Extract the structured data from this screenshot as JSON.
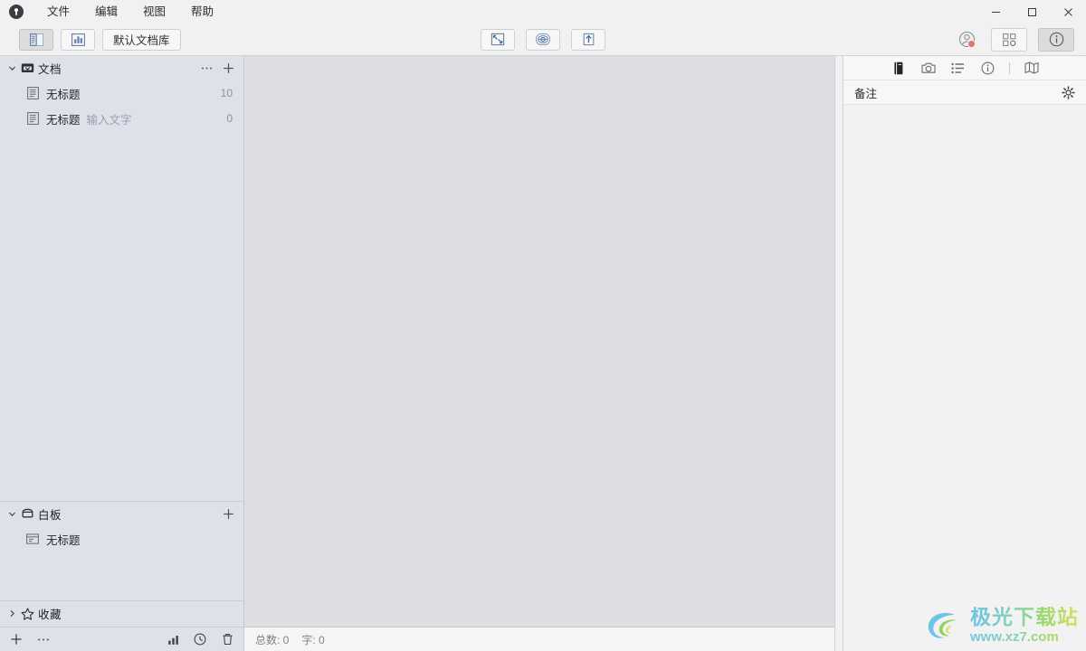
{
  "titlebar": {
    "logo_icon": "app-logo-icon",
    "menus": [
      {
        "label": "文件",
        "name": "menu-file"
      },
      {
        "label": "编辑",
        "name": "menu-edit"
      },
      {
        "label": "视图",
        "name": "menu-view"
      },
      {
        "label": "帮助",
        "name": "menu-help"
      }
    ],
    "window_controls": {
      "minimize": "minimize-icon",
      "maximize": "maximize-icon",
      "close": "close-icon"
    }
  },
  "toolbar": {
    "left": [
      {
        "name": "toggle-sidebar-button",
        "icon": "sidebar-panel-icon",
        "active": true
      },
      {
        "name": "toggle-outline-button",
        "icon": "bar-chart-icon",
        "active": false
      }
    ],
    "library_label": "默认文档库",
    "center": [
      {
        "name": "focus-mode-button",
        "icon": "expand-arrows-icon"
      },
      {
        "name": "typewriter-mode-button",
        "icon": "eye-target-icon"
      },
      {
        "name": "export-button",
        "icon": "upload-arrow-icon"
      }
    ],
    "right": [
      {
        "name": "account-button",
        "icon": "user-avatar-icon",
        "badge": true
      },
      {
        "name": "apps-grid-button",
        "icon": "grid-apps-icon",
        "active": false
      },
      {
        "name": "info-button",
        "icon": "info-circle-icon",
        "active": true
      }
    ]
  },
  "sidebar": {
    "sections": [
      {
        "name": "documents",
        "title": "文档",
        "icon": "inbox-icon",
        "expanded": true,
        "chevron": "chevron-down-icon",
        "actions": [
          {
            "name": "more-options-button",
            "icon": "ellipsis-icon",
            "glyph": "⋯"
          },
          {
            "name": "add-document-button",
            "icon": "plus-icon",
            "glyph": "+"
          }
        ],
        "items": [
          {
            "name": "document-item",
            "icon": "document-icon",
            "title": "无标题",
            "subtitle": "",
            "count": "10"
          },
          {
            "name": "document-item",
            "icon": "document-icon",
            "title": "无标题",
            "subtitle": "输入文字",
            "count": "0"
          }
        ]
      },
      {
        "name": "whiteboard",
        "title": "白板",
        "icon": "whiteboard-box-icon",
        "expanded": true,
        "chevron": "chevron-down-icon",
        "actions": [
          {
            "name": "add-whiteboard-button",
            "icon": "plus-icon",
            "glyph": "+"
          }
        ],
        "items": [
          {
            "name": "whiteboard-item",
            "icon": "whiteboard-item-icon",
            "title": "无标题",
            "subtitle": "",
            "count": ""
          }
        ]
      },
      {
        "name": "favorites",
        "title": "收藏",
        "icon": "star-icon",
        "expanded": false,
        "chevron": "chevron-right-icon",
        "actions": [],
        "items": []
      }
    ],
    "footer": {
      "left": [
        {
          "name": "add-item-button",
          "icon": "plus-icon",
          "glyph": "+"
        },
        {
          "name": "more-menu-button",
          "icon": "ellipsis-icon",
          "glyph": "⋯"
        }
      ],
      "right": [
        {
          "name": "statistics-button",
          "icon": "bar-chart-icon"
        },
        {
          "name": "history-button",
          "icon": "clock-icon"
        },
        {
          "name": "trash-button",
          "icon": "trash-icon"
        }
      ]
    }
  },
  "editor": {
    "statusbar": {
      "total_label": "总数: 0",
      "words_label": "字: 0"
    }
  },
  "rightpanel": {
    "tabs": [
      {
        "name": "tab-notes",
        "icon": "book-icon",
        "active": true
      },
      {
        "name": "tab-snapshot",
        "icon": "camera-icon",
        "active": false
      },
      {
        "name": "tab-outline",
        "icon": "list-icon",
        "active": false
      },
      {
        "name": "tab-info",
        "icon": "info-circle-icon",
        "active": false
      },
      {
        "name": "tab-map",
        "icon": "map-icon",
        "active": false
      }
    ],
    "header_title": "备注",
    "gear_icon": "gear-icon"
  },
  "watermark": {
    "main": "极光下载站",
    "sub": "www.xz7.com",
    "logo_icon": "aurora-swirl-logo-icon"
  },
  "colors": {
    "sidebar_bg": "#dde1ea",
    "editor_bg": "#dcdee2",
    "chrome_bg": "#f1f1f1",
    "panel_bg": "#f7f7f7",
    "badge_red": "#e4756e",
    "icon_blue": "#5f7ea8"
  }
}
